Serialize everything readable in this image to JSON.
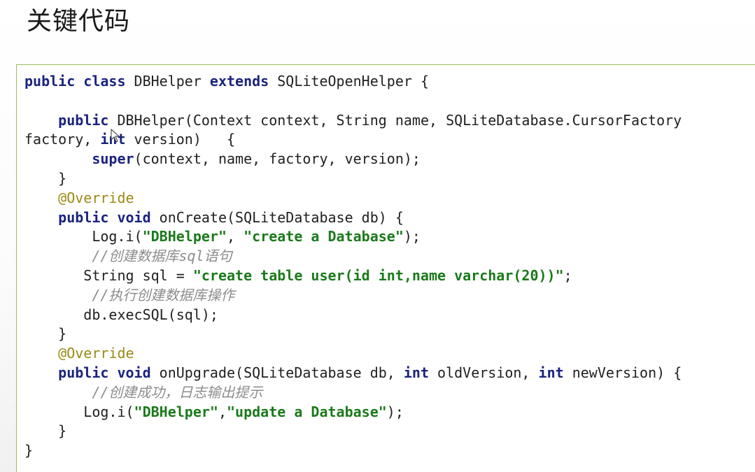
{
  "title": "关键代码",
  "code_lines": [
    [
      [
        "kw",
        "public class"
      ],
      [
        "t",
        " DBHelper "
      ],
      [
        "kw",
        "extends"
      ],
      [
        "t",
        " SQLiteOpenHelper {"
      ]
    ],
    [],
    [
      [
        "t",
        "    "
      ],
      [
        "kw",
        "public"
      ],
      [
        "t",
        " DBHelper(Context context, String name, SQLiteDatabase.CursorFactory"
      ]
    ],
    [
      [
        "t",
        "factory, "
      ],
      [
        "kw",
        "int"
      ],
      [
        "t",
        " version)   {"
      ]
    ],
    [
      [
        "t",
        "        "
      ],
      [
        "kw",
        "super"
      ],
      [
        "t",
        "(context, name, factory, version);"
      ]
    ],
    [
      [
        "t",
        "    }"
      ]
    ],
    [
      [
        "t",
        "    "
      ],
      [
        "ann",
        "@Override"
      ]
    ],
    [
      [
        "t",
        "    "
      ],
      [
        "kw",
        "public void"
      ],
      [
        "t",
        " onCreate(SQLiteDatabase db) {"
      ]
    ],
    [
      [
        "t",
        "        Log.i("
      ],
      [
        "str",
        "\"DBHelper\""
      ],
      [
        "t",
        ", "
      ],
      [
        "str",
        "\"create a Database\""
      ],
      [
        "t",
        ");"
      ]
    ],
    [
      [
        "t",
        "        "
      ],
      [
        "cmt",
        "//创建数据库sql语句"
      ]
    ],
    [
      [
        "t",
        "       String sql = "
      ],
      [
        "str",
        "\"create table user(id int,name varchar(20))\""
      ],
      [
        "t",
        ";"
      ]
    ],
    [
      [
        "t",
        "        "
      ],
      [
        "cmt",
        "//执行创建数据库操作"
      ]
    ],
    [
      [
        "t",
        "       db.execSQL(sql);"
      ]
    ],
    [
      [
        "t",
        "    }"
      ]
    ],
    [
      [
        "t",
        "    "
      ],
      [
        "ann",
        "@Override"
      ]
    ],
    [
      [
        "t",
        "    "
      ],
      [
        "kw",
        "public void"
      ],
      [
        "t",
        " onUpgrade(SQLiteDatabase db, "
      ],
      [
        "kw",
        "int"
      ],
      [
        "t",
        " oldVersion, "
      ],
      [
        "kw",
        "int"
      ],
      [
        "t",
        " newVersion) {"
      ]
    ],
    [
      [
        "t",
        "        "
      ],
      [
        "cmt",
        "//创建成功，日志输出提示"
      ]
    ],
    [
      [
        "t",
        "       Log.i("
      ],
      [
        "str",
        "\"DBHelper\""
      ],
      [
        "t",
        ","
      ],
      [
        "str",
        "\"update a Database\""
      ],
      [
        "t",
        ");"
      ]
    ],
    [
      [
        "t",
        "    }"
      ]
    ],
    [
      [
        "t",
        "}"
      ]
    ]
  ]
}
